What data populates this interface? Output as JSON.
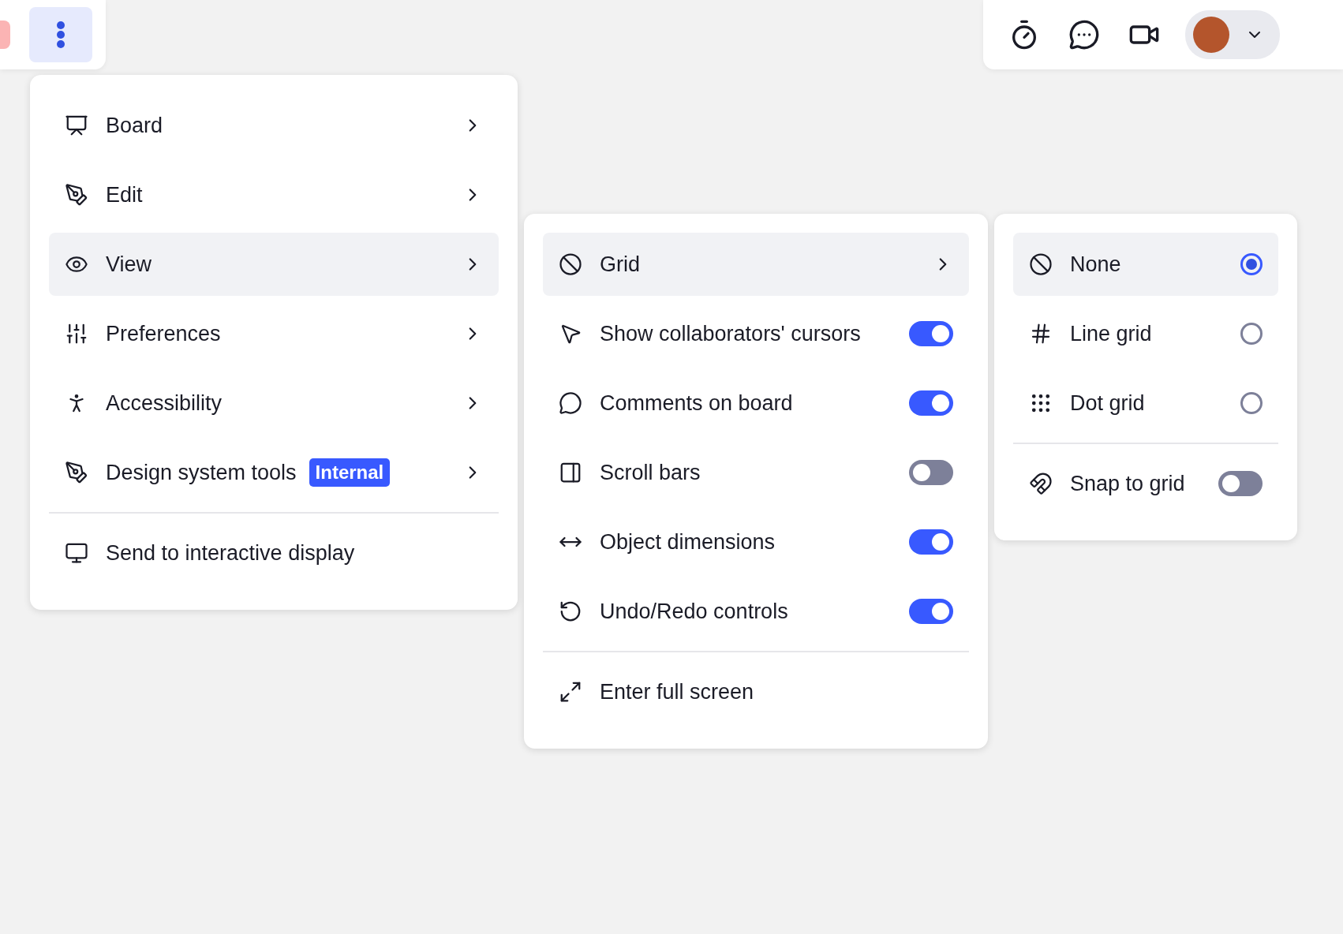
{
  "main_menu": {
    "items": [
      {
        "label": "Board",
        "selected": false
      },
      {
        "label": "Edit",
        "selected": false
      },
      {
        "label": "View",
        "selected": true
      },
      {
        "label": "Preferences",
        "selected": false
      },
      {
        "label": "Accessibility",
        "selected": false
      },
      {
        "label": "Design system tools",
        "selected": false,
        "badge": "Internal"
      }
    ],
    "footer_item": "Send to interactive display"
  },
  "view_menu": {
    "items": [
      {
        "kind": "submenu",
        "label": "Grid",
        "selected": true
      },
      {
        "kind": "toggle",
        "label": "Show collaborators' cursors",
        "on": true
      },
      {
        "kind": "toggle",
        "label": "Comments on board",
        "on": true
      },
      {
        "kind": "toggle",
        "label": "Scroll bars",
        "on": false
      },
      {
        "kind": "toggle",
        "label": "Object dimensions",
        "on": true
      },
      {
        "kind": "toggle",
        "label": "Undo/Redo controls",
        "on": true
      }
    ],
    "footer_item": "Enter full screen"
  },
  "grid_menu": {
    "options": [
      {
        "label": "None",
        "selected": true
      },
      {
        "label": "Line grid",
        "selected": false
      },
      {
        "label": "Dot grid",
        "selected": false
      }
    ],
    "snap": {
      "label": "Snap to grid",
      "on": false
    }
  }
}
